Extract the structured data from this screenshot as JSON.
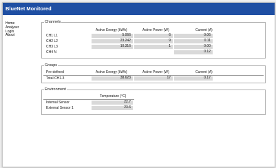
{
  "app": {
    "title": "BlueNet Monitored"
  },
  "nav": [
    "Home",
    "Analyser",
    "Login",
    "About"
  ],
  "channels": {
    "legend": "Channels",
    "headers": {
      "energy": "Active Energy (kWh)",
      "power": "Active Power (W)",
      "current": "Current (A)"
    },
    "rows": [
      {
        "label": "CH1 L1",
        "energy": "5.066",
        "power": "6",
        "current": "0.06"
      },
      {
        "label": "CH2 L2",
        "energy": "23.242",
        "power": "9",
        "current": "0.11"
      },
      {
        "label": "CH3 L3",
        "energy": "10.316",
        "power": "1",
        "current": "0.00"
      },
      {
        "label": "CH4 N",
        "energy": "",
        "power": "",
        "current": "0.12"
      }
    ]
  },
  "groups": {
    "legend": "Groups",
    "header_label": "Pre-defined",
    "headers": {
      "energy": "Active Energy (kWh)",
      "power": "Active Power (W)",
      "current": "Current (A)"
    },
    "row": {
      "label": "Total CH1-3",
      "energy": "38.623",
      "power": "17",
      "current": "0.17"
    }
  },
  "environment": {
    "legend": "Environment",
    "header": "Temperature (°C)",
    "rows": [
      {
        "label": "Internal Sensor",
        "value": "22.7"
      },
      {
        "label": "External Sensor 1",
        "value": "23.6"
      }
    ]
  },
  "colors": {
    "topbar": "#1f4fa3",
    "cell": "#d9d9d9"
  }
}
